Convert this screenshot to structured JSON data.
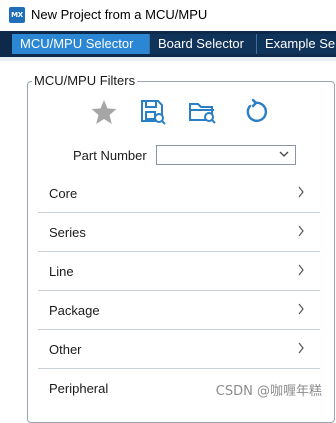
{
  "window": {
    "app_badge": "MX",
    "title": "New Project from a MCU/MPU"
  },
  "tabs": [
    {
      "label": "MCU/MPU Selector",
      "active": true
    },
    {
      "label": "Board Selector",
      "active": false
    },
    {
      "label": "Example Se",
      "active": false
    }
  ],
  "filters": {
    "title": "MCU/MPU Filters",
    "icons": [
      "star-icon",
      "save-search-icon",
      "open-folder-search-icon",
      "reset-icon"
    ],
    "part_number_label": "Part Number",
    "part_number_value": ""
  },
  "categories": [
    {
      "label": "Core"
    },
    {
      "label": "Series"
    },
    {
      "label": "Line"
    },
    {
      "label": "Package"
    },
    {
      "label": "Other"
    },
    {
      "label": "Peripheral"
    }
  ],
  "watermark": "CSDN @咖喱年糕",
  "colors": {
    "tabbar_bg": "#0d2a4a",
    "tab_active_bg": "#2b86d3",
    "icon_blue": "#2b7fc4",
    "star_gray": "#a6a6a6"
  }
}
